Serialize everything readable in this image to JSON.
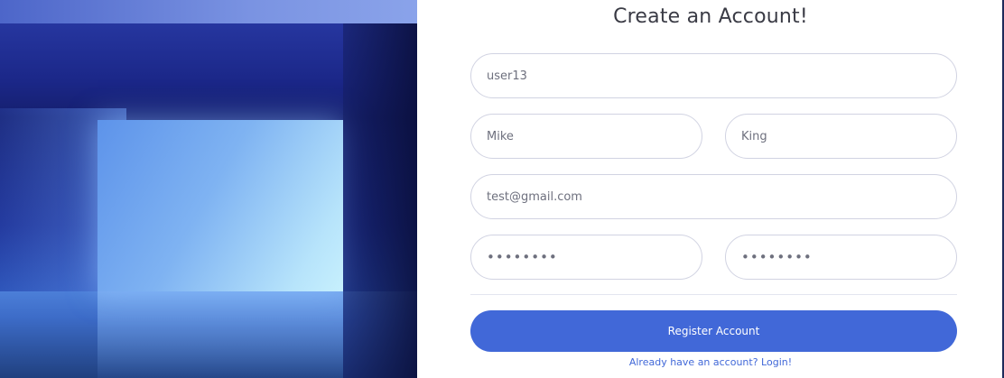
{
  "form": {
    "title": "Create an Account!",
    "username": {
      "value": "user13"
    },
    "first_name": {
      "value": "Mike"
    },
    "last_name": {
      "value": "King"
    },
    "email": {
      "value": "test@gmail.com"
    },
    "password": {
      "value": "password"
    },
    "repeat_password": {
      "value": "password"
    },
    "register_label": "Register Account",
    "login_link_label": "Already have an account? Login!"
  },
  "colors": {
    "primary": "#4168d8",
    "field_border": "#d1d3e2",
    "title_text": "#3a3b45",
    "field_text": "#6e707e"
  },
  "hero": {
    "icon": "illuminated-doorway-image"
  }
}
